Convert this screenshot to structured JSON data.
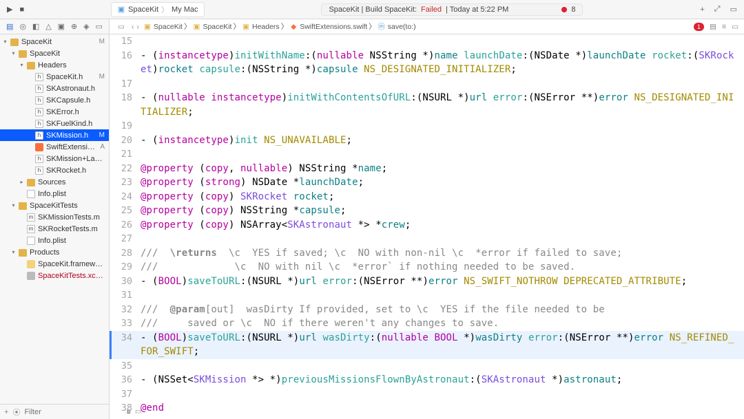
{
  "titlebar": {
    "scheme": {
      "app": "SpaceKit",
      "device": "My Mac"
    },
    "status": {
      "prefix": "SpaceKit | Build SpaceKit:",
      "state": "Failed",
      "suffix": "| Today at 5:22 PM",
      "count": "8"
    },
    "icons": {
      "play": "▶",
      "stop": "■",
      "plus": "+",
      "expand": "⤢",
      "panelR": "▭"
    }
  },
  "nav": {
    "tabs": [
      "▤",
      "◎",
      "◧",
      "△",
      "▣",
      "⊕",
      "◈",
      "▭"
    ],
    "filter_placeholder": "Filter",
    "tree": [
      {
        "d": 0,
        "disc": "▾",
        "ico": "folder",
        "name": "SpaceKit",
        "badge": "M"
      },
      {
        "d": 1,
        "disc": "▾",
        "ico": "fold",
        "name": "SpaceKit"
      },
      {
        "d": 2,
        "disc": "▾",
        "ico": "fold",
        "name": "Headers"
      },
      {
        "d": 3,
        "disc": "",
        "ico": "h",
        "name": "SpaceKit.h",
        "badge": "M"
      },
      {
        "d": 3,
        "disc": "",
        "ico": "h",
        "name": "SKAstronaut.h"
      },
      {
        "d": 3,
        "disc": "",
        "ico": "h",
        "name": "SKCapsule.h"
      },
      {
        "d": 3,
        "disc": "",
        "ico": "h",
        "name": "SKError.h"
      },
      {
        "d": 3,
        "disc": "",
        "ico": "h",
        "name": "SKFuelKind.h"
      },
      {
        "d": 3,
        "disc": "",
        "ico": "h",
        "name": "SKMission.h",
        "badge": "M",
        "sel": true
      },
      {
        "d": 3,
        "disc": "",
        "ico": "swift",
        "name": "SwiftExtensions.swift",
        "badge": "A"
      },
      {
        "d": 3,
        "disc": "",
        "ico": "h",
        "name": "SKMission+Launch.h"
      },
      {
        "d": 3,
        "disc": "",
        "ico": "h",
        "name": "SKRocket.h"
      },
      {
        "d": 2,
        "disc": "▸",
        "ico": "fold",
        "name": "Sources"
      },
      {
        "d": 2,
        "disc": "",
        "ico": "plist",
        "name": "Info.plist"
      },
      {
        "d": 1,
        "disc": "▾",
        "ico": "fold",
        "name": "SpaceKitTests"
      },
      {
        "d": 2,
        "disc": "",
        "ico": "m",
        "name": "SKMissionTests.m"
      },
      {
        "d": 2,
        "disc": "",
        "ico": "m",
        "name": "SKRocketTests.m"
      },
      {
        "d": 2,
        "disc": "",
        "ico": "plist",
        "name": "Info.plist"
      },
      {
        "d": 1,
        "disc": "▾",
        "ico": "fold",
        "name": "Products"
      },
      {
        "d": 2,
        "disc": "",
        "ico": "fw",
        "name": "SpaceKit.framework"
      },
      {
        "d": 2,
        "disc": "",
        "ico": "xct",
        "name": "SpaceKitTests.xctest",
        "err": true
      }
    ]
  },
  "jumpbar": {
    "arrows": {
      "back": "‹",
      "fwd": "›"
    },
    "crumbs": [
      {
        "ico": "folder",
        "label": "SpaceKit"
      },
      {
        "ico": "fold",
        "label": "SpaceKit"
      },
      {
        "ico": "fold",
        "label": "Headers"
      },
      {
        "ico": "swift",
        "label": "SwiftExtensions.swift"
      },
      {
        "ico": "sym",
        "label": "save(to:)"
      }
    ],
    "err": "1"
  },
  "code": {
    "gutter_start": 15,
    "current_line": 34,
    "lines": [
      {
        "n": 15,
        "t": ""
      },
      {
        "n": 16,
        "t": "- (<kw>instancetype</kw>)<me>initWithName</me>:(<kw>nullable</kw> NSString *)<na>name</na> <me>launchDate</me>:(NSDate *)<na>launchDate</na> <me>rocket</me>:(<ty>SKRocket</ty>)<na>rocket</na> <me>capsule</me>:(NSString *)<na>capsule</na> <mc>NS_DESIGNATED_INITIALIZER</mc>;"
      },
      {
        "n": 17,
        "t": ""
      },
      {
        "n": 18,
        "t": "- (<kw>nullable</kw> <kw>instancetype</kw>)<me>initWithContentsOfURL</me>:(NSURL *)<na>url</na> <me>error</me>:(NSError **)<na>error</na> <mc>NS_DESIGNATED_INITIALIZER</mc>;"
      },
      {
        "n": 19,
        "t": ""
      },
      {
        "n": 20,
        "t": "- (<kw>instancetype</kw>)<me>init</me> <mc>NS_UNAVAILABLE</mc>;"
      },
      {
        "n": 21,
        "t": ""
      },
      {
        "n": 22,
        "t": "<kw>@property</kw> (<kw>copy</kw>, <kw>nullable</kw>) NSString *<na>name</na>;"
      },
      {
        "n": 23,
        "t": "<kw>@property</kw> (<kw>strong</kw>) NSDate *<na>launchDate</na>;"
      },
      {
        "n": 24,
        "t": "<kw>@property</kw> (<kw>copy</kw>) <ty>SKRocket</ty> <na>rocket</na>;"
      },
      {
        "n": 25,
        "t": "<kw>@property</kw> (<kw>copy</kw>) NSString *<na>capsule</na>;"
      },
      {
        "n": 26,
        "t": "<kw>@property</kw> (<kw>copy</kw>) NSArray&lt;<ty>SKAstronaut</ty> *&gt; *<na>crew</na>;"
      },
      {
        "n": 27,
        "t": ""
      },
      {
        "n": 28,
        "t": "<cm>///  <b>\\returns</b>  \\c  YES if saved; \\c  NO with non-nil \\c  *error if failed to save;</cm>"
      },
      {
        "n": 29,
        "t": "<cm>///             \\c  NO with nil \\c  *error` if nothing needed to be saved.</cm>"
      },
      {
        "n": 30,
        "t": "- (<kw>BOOL</kw>)<me>saveToURL</me>:(NSURL *)<na>url</na> <me>error</me>:(NSError **)<na>error</na> <mc>NS_SWIFT_NOTHROW</mc> <mc>DEPRECATED_ATTRIBUTE</mc>;"
      },
      {
        "n": 31,
        "t": ""
      },
      {
        "n": 32,
        "t": "<cm>///  <b>@param</b>[out]  wasDirty If provided, set to \\c  YES if the file needed to be</cm>"
      },
      {
        "n": 33,
        "t": "<cm>///     saved or \\c  NO if there weren't any changes to save.</cm>"
      },
      {
        "n": 34,
        "t": "- (<kw>BOOL</kw>)<me>saveToURL</me>:(NSURL *)<na>url</na> <me>wasDirty</me>:(<kw>nullable</kw> <kw>BOOL</kw> *)<na>wasDirty</na> <me>error</me>:(NSError **)<na>error</na> <mc>NS_REFINED_FOR_SWIFT</mc>;"
      },
      {
        "n": 35,
        "t": ""
      },
      {
        "n": 36,
        "t": "- (NSSet&lt;<ty>SKMission</ty> *&gt; *)<me>previousMissionsFlownByAstronaut</me>:(<ty>SKAstronaut</ty> *)<na>astronaut</na>;"
      },
      {
        "n": 37,
        "t": ""
      },
      {
        "n": 38,
        "t": "<kw>@end</kw>"
      }
    ]
  }
}
